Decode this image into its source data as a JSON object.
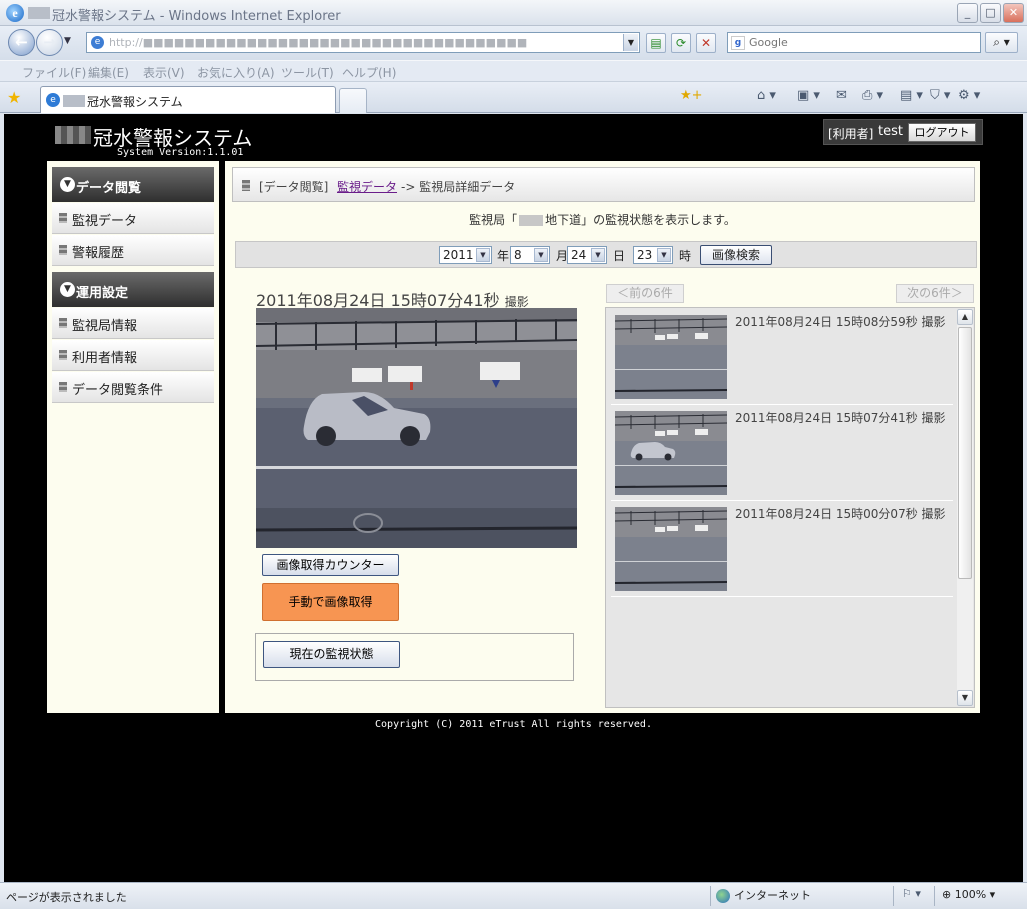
{
  "browser": {
    "window_title": "冠水警報システム - Windows Internet Explorer",
    "search_placeholder": "Google",
    "menu": [
      "ファイル(F)",
      "編集(E)",
      "表示(V)",
      "お気に入り(A)",
      "ツール(T)",
      "ヘルプ(H)"
    ],
    "tab_title": "冠水警報システム",
    "status_message": "ページが表示されました",
    "zone": "インターネット",
    "zoom": "100%"
  },
  "header": {
    "app_name": "冠水警報システム",
    "version": "System Version:1.1.01",
    "user_role": "[利用者]",
    "user_name": "test",
    "logout_label": "ログアウト"
  },
  "sidebar": {
    "sections": [
      {
        "title": "データ閲覧",
        "items": [
          "監視データ",
          "警報履歴"
        ]
      },
      {
        "title": "運用設定",
        "items": [
          "監視局情報",
          "利用者情報",
          "データ閲覧条件"
        ]
      }
    ]
  },
  "breadcrumb": {
    "section": "[データ閲覧]",
    "link": "監視データ",
    "current": "-> 監視局詳細データ"
  },
  "description": {
    "before": "監視局「",
    "after": "地下道」の監視状態を表示します。"
  },
  "search": {
    "year": "2011",
    "year_label": "年",
    "month": "8",
    "month_label": "月",
    "day": "24",
    "day_label": "日",
    "hour": "23",
    "hour_label": "時",
    "button": "画像検索"
  },
  "current_image": {
    "caption": "2011年08月24日 15時07分41秒",
    "caption_suffix": "撮影",
    "counter_button": "画像取得カウンター",
    "manual_button": "手動で画像取得",
    "status_button": "現在の監視状態"
  },
  "pager": {
    "prev": "＜前の6件",
    "next": "次の6件＞"
  },
  "thumbnails": [
    {
      "label": "2011年08月24日 15時08分59秒 撮影",
      "car": false
    },
    {
      "label": "2011年08月24日 15時07分41秒 撮影",
      "car": true
    },
    {
      "label": "2011年08月24日 15時00分07秒 撮影",
      "car": false
    }
  ],
  "footer": {
    "copyright": "Copyright (C) 2011 eTrust All rights reserved."
  }
}
